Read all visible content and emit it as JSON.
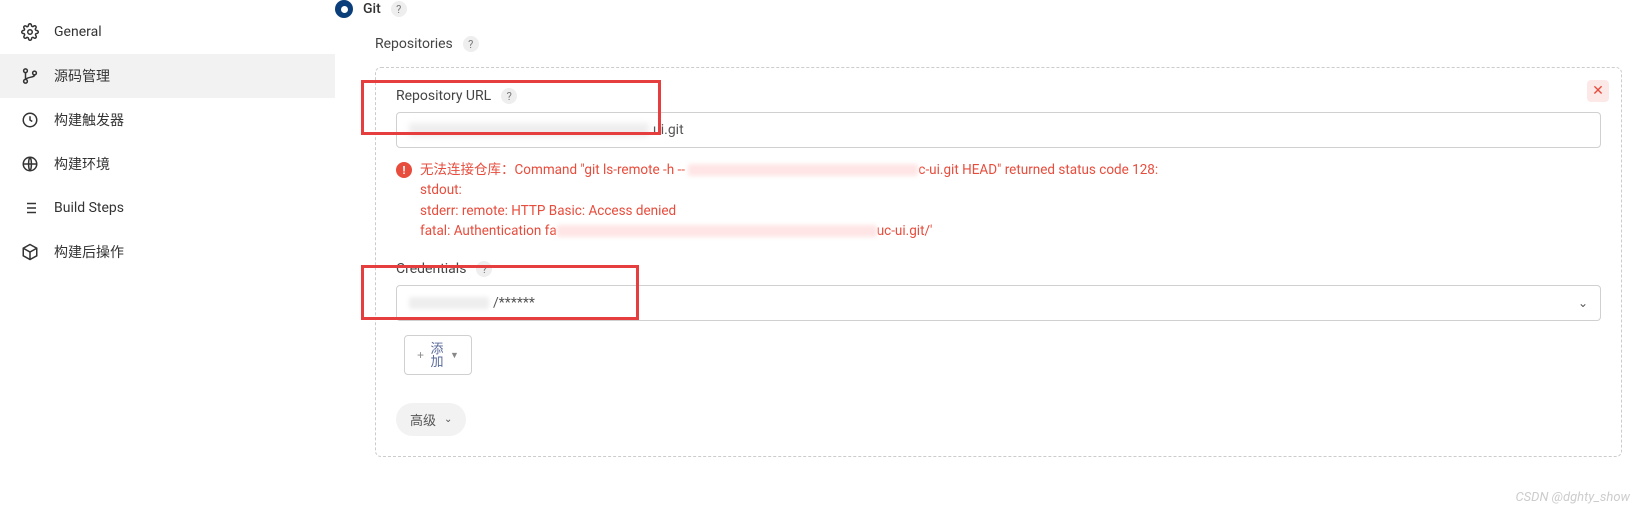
{
  "sidebar": {
    "items": [
      {
        "label": "General",
        "icon": "gear"
      },
      {
        "label": "源码管理",
        "icon": "branch"
      },
      {
        "label": "构建触发器",
        "icon": "clock"
      },
      {
        "label": "构建环境",
        "icon": "globe"
      },
      {
        "label": "Build Steps",
        "icon": "list"
      },
      {
        "label": "构建后操作",
        "icon": "package"
      }
    ]
  },
  "scm": {
    "type": "Git",
    "repositories_label": "Repositories",
    "repo_url_label": "Repository URL",
    "repo_url_suffix": "ui.git",
    "error": {
      "line1_prefix": "无法连接仓库：Command \"git ls-remote -h -- ",
      "line1_suffix": "c-ui.git HEAD\" returned status code 128:",
      "line2": "stdout:",
      "line3": "stderr: remote: HTTP Basic: Access denied",
      "line4_prefix": "fatal: Authentication fa",
      "line4_suffix": "uc-ui.git/'"
    },
    "credentials_label": "Credentials",
    "credentials_value": "/******",
    "add_button": "添加",
    "advanced_button": "高级"
  },
  "watermark": "CSDN @dghty_show"
}
